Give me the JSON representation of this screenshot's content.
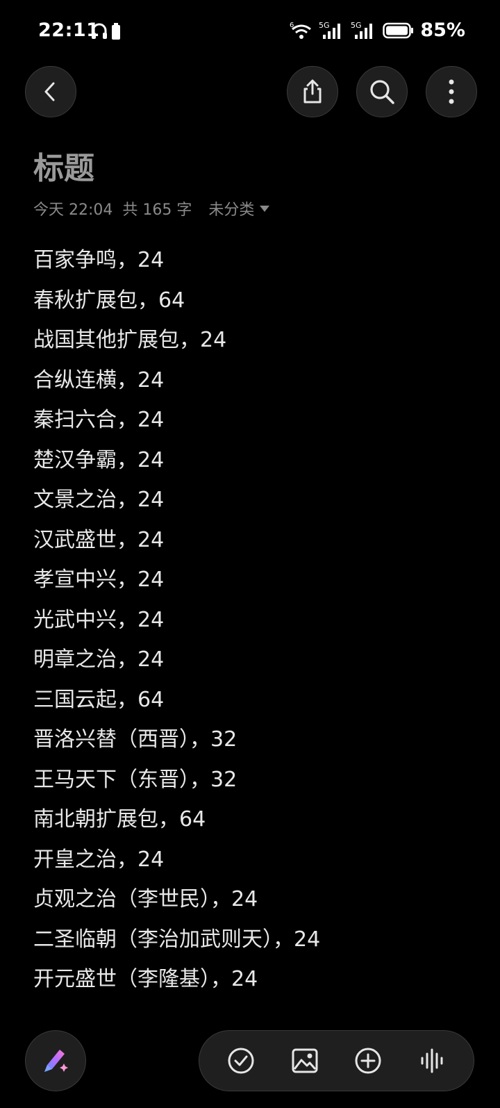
{
  "status_bar": {
    "time": "22:11",
    "battery_percent": "85%",
    "wifi_label": "6",
    "sim1_label": "5G",
    "sim2_label": "5G"
  },
  "toolbar": {
    "back_icon": "chevron-left-icon",
    "share_icon": "share-icon",
    "search_icon": "search-icon",
    "more_icon": "more-vertical-icon"
  },
  "note": {
    "title": "标题",
    "date": "今天 22:04",
    "word_count": "共 165 字",
    "category": "未分类",
    "lines": [
      "百家争鸣，24",
      "春秋扩展包，64",
      "战国其他扩展包，24",
      "合纵连横，24",
      "秦扫六合，24",
      "楚汉争霸，24",
      "文景之治，24",
      "汉武盛世，24",
      "孝宣中兴，24",
      "光武中兴，24",
      "明章之治，24",
      "三国云起，64",
      "晋洛兴替（西晋），32",
      "王马天下（东晋），32",
      "南北朝扩展包，64",
      "开皇之治，24",
      "贞观之治（李世民），24",
      "二圣临朝（李治加武则天），24",
      "开元盛世（李隆基），24"
    ]
  },
  "bottom_bar": {
    "ai_icon": "ai-pen-icon",
    "checklist_icon": "checklist-icon",
    "image_icon": "image-icon",
    "add_icon": "add-circle-icon",
    "voice_icon": "voice-wave-icon"
  }
}
